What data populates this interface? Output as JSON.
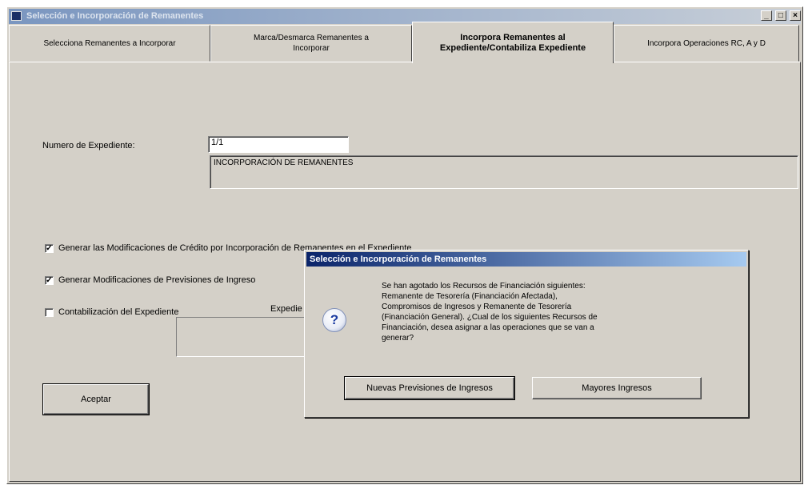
{
  "window": {
    "title": "Selección e Incorporación de Remanentes",
    "controls": [
      "_",
      "□",
      "×"
    ]
  },
  "tabs": [
    {
      "label": "Selecciona Remanentes a Incorporar"
    },
    {
      "label": "Marca/Desmarca Remanentes a Incorporar"
    },
    {
      "label": "Incorpora Remanentes al Expediente/Contabiliza Expediente"
    },
    {
      "label": "Incorpora Operaciones RC, A y D"
    }
  ],
  "form": {
    "expediente_label": "Numero de Expediente:",
    "expediente_value": "1/1",
    "description": "INCORPORACIÓN DE REMANENTES",
    "check1_label": "Generar las Modificaciones de Crédito por Incorporación de Remanentes en el Expediente",
    "check2_label": "Generar Modificaciones de Previsiones de Ingreso",
    "check3_label": "Contabilización del Expediente",
    "expediente_group_label": "Expedie",
    "accept_button": "Aceptar"
  },
  "dialog": {
    "title": "Selección e Incorporación de Remanentes",
    "icon": "question-icon",
    "message_lines": [
      "Se han agotado los Recursos de Financiación siguientes:",
      "Remanente de Tesorería (Financiación Afectada),",
      "Compromisos de Ingresos y Remanente de Tesorería",
      "(Financiación General). ¿Cual de los siguientes Recursos de",
      "Financiación, desea asignar a las operaciones que se van a",
      "generar?"
    ],
    "button1": "Nuevas Previsiones de Ingresos",
    "button2": "Mayores Ingresos"
  }
}
